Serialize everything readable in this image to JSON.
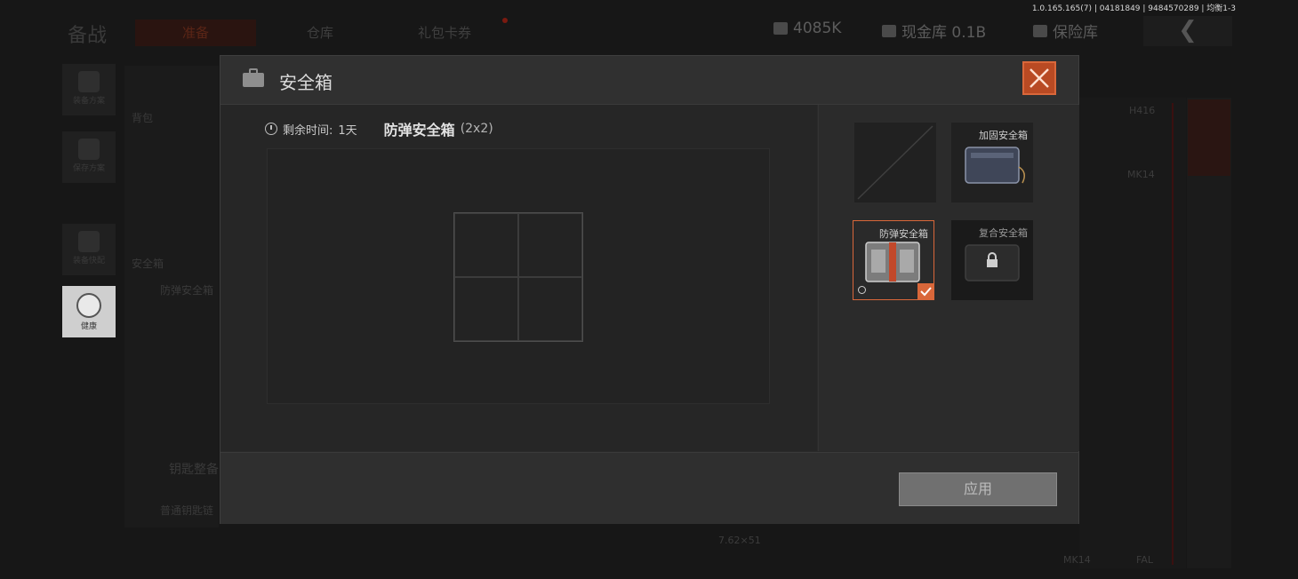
{
  "build_info": "1.0.165.165(7) | 04181849 | 9484570289 | 均衡1-3",
  "background": {
    "title": "备战",
    "tabs": [
      "准备",
      "仓库",
      "礼包卡券"
    ],
    "silver_value": "4085K",
    "cash_vault": "现金库 0.1B",
    "insurance": "保险库",
    "back_glyph": "❮",
    "side_buttons": [
      "装备方案",
      "保存方案",
      "装备快配",
      "健康"
    ],
    "panel_labels": [
      "背包",
      "安全箱",
      "防弹安全箱",
      "钥匙整备",
      "普通钥匙链"
    ],
    "item_labels": [
      "H416",
      "MK14",
      "MK14",
      "FAL",
      "7.62×51"
    ]
  },
  "modal": {
    "title": "安全箱",
    "remaining_label": "剩余时间:",
    "remaining_value": "1天",
    "current_case_name": "防弹安全箱",
    "current_case_size": "(2x2)",
    "apply_label": "应用",
    "cases": [
      {
        "name": "",
        "state": "empty"
      },
      {
        "name": "加固安全箱",
        "state": "available"
      },
      {
        "name": "防弹安全箱",
        "state": "selected"
      },
      {
        "name": "复合安全箱",
        "state": "locked"
      }
    ]
  },
  "colors": {
    "accent": "#d9673a",
    "close_bg": "#b94a23",
    "modal_bg": "#2a2a2a",
    "apply_bg": "#707070"
  }
}
